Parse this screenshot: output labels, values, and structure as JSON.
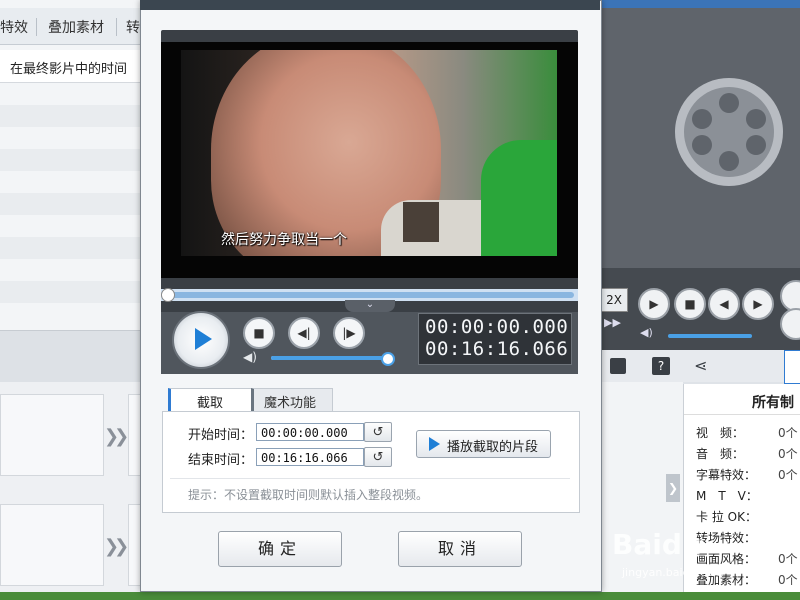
{
  "background": {
    "top_tabs": [
      "特效",
      "叠加素材",
      "转"
    ],
    "column_header": "在最终影片中的时间",
    "right_panel": {
      "title": "所有制",
      "speed_label": "2X",
      "info_rows": [
        {
          "label": "视　频：",
          "value": "0个"
        },
        {
          "label": "音　频：",
          "value": "0个"
        },
        {
          "label": "字幕特效：",
          "value": "0个"
        },
        {
          "label": "M　T　V：",
          "value": ""
        },
        {
          "label": "卡 拉 OK：",
          "value": ""
        },
        {
          "label": "转场特效：",
          "value": ""
        },
        {
          "label": "画面风格：",
          "value": "0个"
        },
        {
          "label": "叠加素材：",
          "value": "0个"
        }
      ]
    },
    "watermark": "Baidu",
    "watermark_sub": "jingyan.baidu.com"
  },
  "dialog": {
    "video": {
      "subtitle": "然后努力争取当一个"
    },
    "player": {
      "current_time": "00:00:00.000",
      "total_time": "00:16:16.066",
      "seek_fraction": 0.0,
      "volume_fraction": 0.97,
      "collapse_glyph": "⌄"
    },
    "tabs": [
      {
        "label": "截取"
      },
      {
        "label": "魔术功能"
      }
    ],
    "trim": {
      "start_label": "开始时间：",
      "start_value": "00:00:00.000",
      "end_label": "结束时间：",
      "end_value": "00:16:16.066",
      "reset_glyph": "↺",
      "play_segment_label": "播放截取的片段"
    },
    "hint": "提示：不设置截取时间则默认插入整段视频。",
    "buttons": {
      "ok": "确定",
      "cancel": "取消"
    }
  },
  "colors": {
    "accent_blue": "#1f7fd6",
    "player_dark": "#50565d",
    "dialog_bg": "#f4f6f8"
  },
  "icons": {
    "play": "play-icon",
    "stop": "stop-icon",
    "prev": "previous-frame-icon",
    "next": "next-frame-icon",
    "volume": "speaker-icon",
    "reset": "reset-time-icon",
    "film": "film-reel-icon"
  }
}
